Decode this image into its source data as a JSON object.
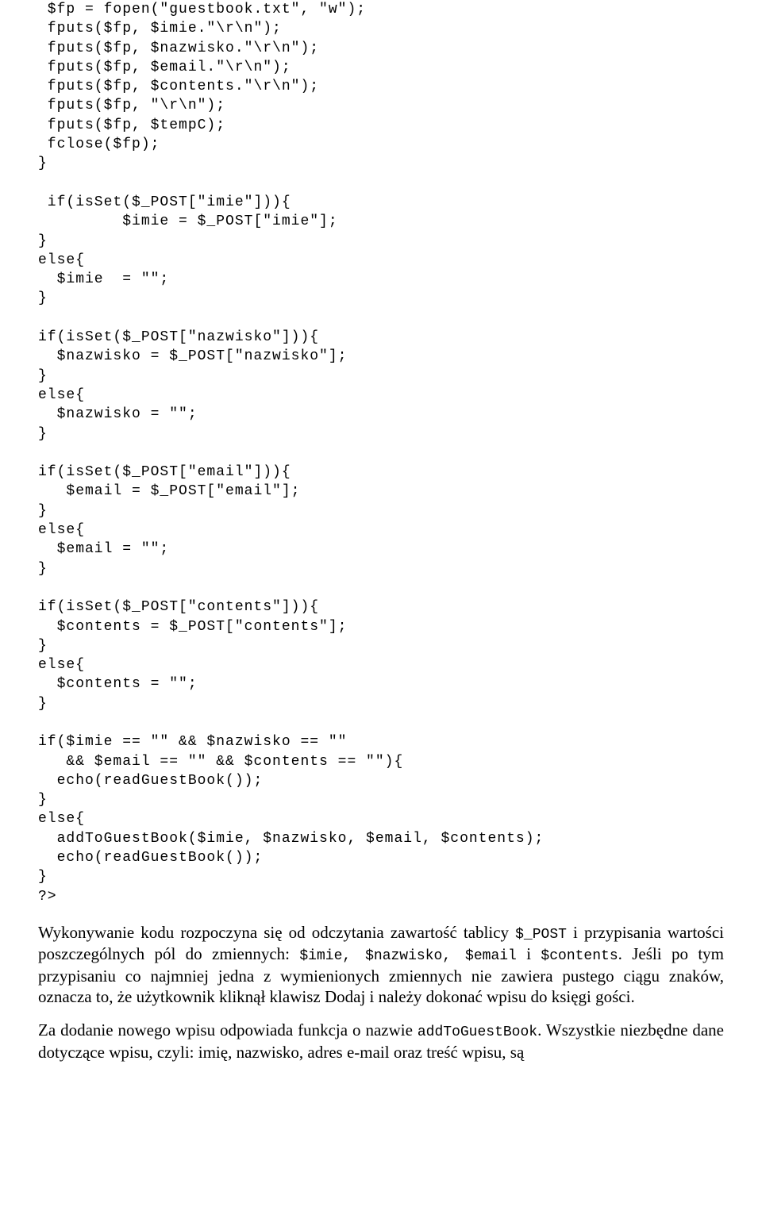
{
  "code": " $fp = fopen(\"guestbook.txt\", \"w\");\n fputs($fp, $imie.\"\\r\\n\");\n fputs($fp, $nazwisko.\"\\r\\n\");\n fputs($fp, $email.\"\\r\\n\");\n fputs($fp, $contents.\"\\r\\n\");\n fputs($fp, \"\\r\\n\");\n fputs($fp, $tempC);\n fclose($fp);\n}\n\n if(isSet($_POST[\"imie\"])){\n         $imie = $_POST[\"imie\"];\n}\nelse{\n  $imie  = \"\";\n}\n\nif(isSet($_POST[\"nazwisko\"])){\n  $nazwisko = $_POST[\"nazwisko\"];\n}\nelse{\n  $nazwisko = \"\";\n}\n\nif(isSet($_POST[\"email\"])){\n   $email = $_POST[\"email\"];\n}\nelse{\n  $email = \"\";\n}\n\nif(isSet($_POST[\"contents\"])){\n  $contents = $_POST[\"contents\"];\n}\nelse{\n  $contents = \"\";\n}\n\nif($imie == \"\" && $nazwisko == \"\"\n   && $email == \"\" && $contents == \"\"){\n  echo(readGuestBook());\n}\nelse{\n  addToGuestBook($imie, $nazwisko, $email, $contents);\n  echo(readGuestBook());\n}\n?>",
  "para1_a": "Wykonywanie kodu rozpoczyna się od odczytania zawartość tablicy ",
  "para1_b": "$_POST",
  "para1_c": " i przypisania wartości poszczególnych pól do zmiennych: ",
  "para1_d": "$imie, $nazwisko, $email",
  "para1_e": " i ",
  "para1_f": "$contents",
  "para1_g": ". Jeśli po tym przypisaniu co najmniej jedna z wymienionych zmiennych nie zawiera pustego ciągu znaków, oznacza to, że użytkownik kliknął klawisz Dodaj i należy dokonać wpisu do księgi gości.",
  "para2_a": "Za dodanie nowego wpisu odpowiada funkcja o nazwie ",
  "para2_b": "addToGuestBook",
  "para2_c": ". Wszystkie niezbędne dane dotyczące wpisu, czyli: imię, nazwisko, adres e-mail oraz treść wpisu, są"
}
